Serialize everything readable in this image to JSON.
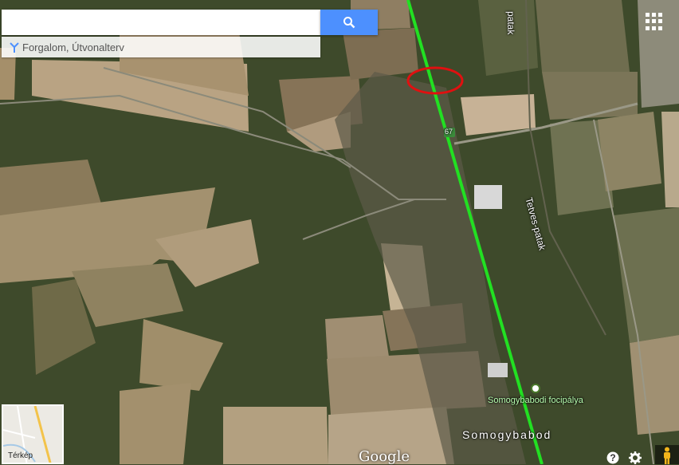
{
  "search": {
    "placeholder": "",
    "value": ""
  },
  "directions": {
    "label": "Forgalom, Útvonalterv",
    "icon": "directions-icon"
  },
  "icons": {
    "search": "search-icon",
    "apps": "apps-grid-icon",
    "help": "help-icon",
    "settings": "gear-icon",
    "pegman": "pegman-icon"
  },
  "map": {
    "labels": {
      "road_number": "67",
      "patak_top": "patak",
      "tetves_patak": "Tetves-patak",
      "focipalya": "Somogybabodi focipálya",
      "town": "Somogybabod"
    },
    "highlight_route_color": "#22e022",
    "circle_color": "#e01010"
  },
  "minimap": {
    "label": "Térkép"
  },
  "attribution": {
    "logo": "Google"
  }
}
